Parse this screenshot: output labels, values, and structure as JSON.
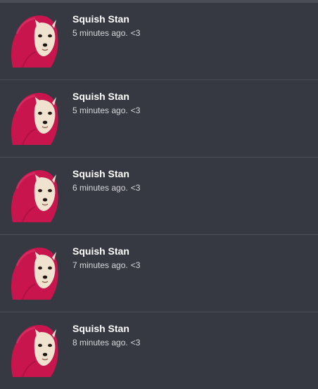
{
  "colors": {
    "background": "#363941",
    "divider": "#4b4e56",
    "name": "#ffffff",
    "meta": "#d7d8dc",
    "hood": "#c8154d",
    "dog": "#efe2cf"
  },
  "feed": {
    "items": [
      {
        "name": "Squish Stan",
        "time": "5 minutes ago.",
        "suffix": "<3",
        "avatar_icon": "chihuahua-in-red-hoodie"
      },
      {
        "name": "Squish Stan",
        "time": "5 minutes ago.",
        "suffix": "<3",
        "avatar_icon": "chihuahua-in-red-hoodie"
      },
      {
        "name": "Squish Stan",
        "time": "6 minutes ago.",
        "suffix": "<3",
        "avatar_icon": "chihuahua-in-red-hoodie"
      },
      {
        "name": "Squish Stan",
        "time": "7 minutes ago.",
        "suffix": "<3",
        "avatar_icon": "chihuahua-in-red-hoodie"
      },
      {
        "name": "Squish Stan",
        "time": "8 minutes ago.",
        "suffix": "<3",
        "avatar_icon": "chihuahua-in-red-hoodie"
      }
    ]
  }
}
